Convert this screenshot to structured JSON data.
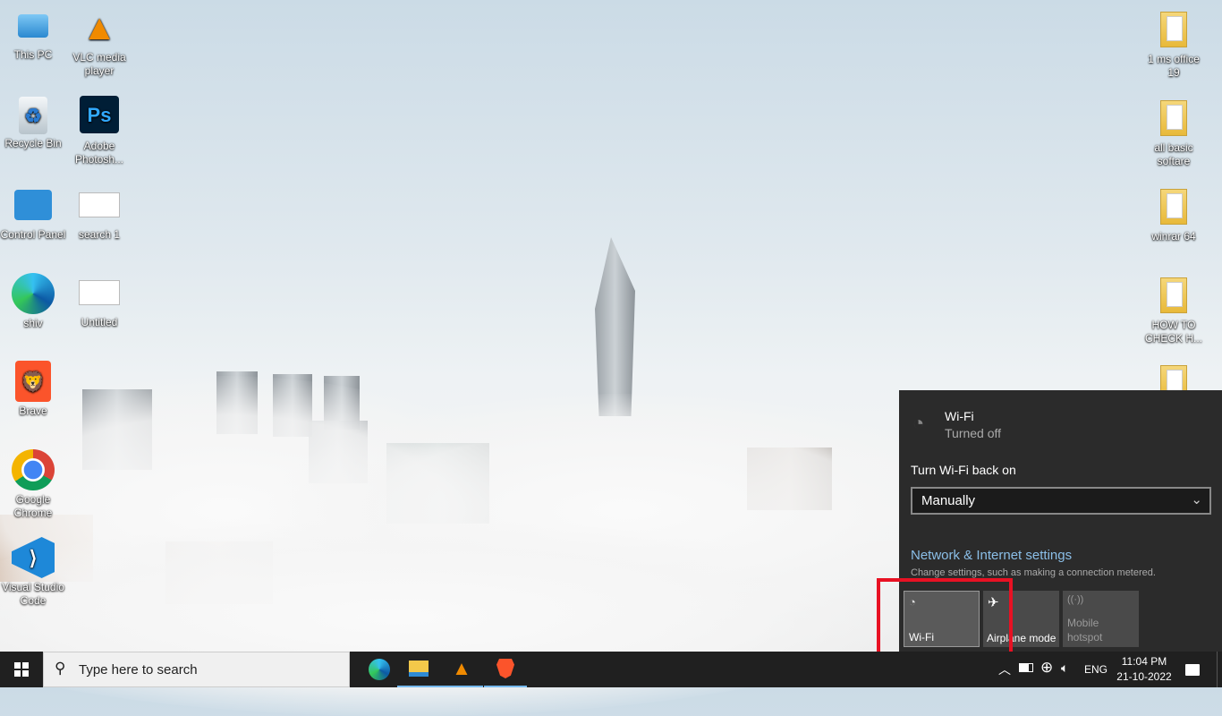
{
  "desktop": {
    "left_icons": [
      {
        "label": "This PC",
        "icon": "computer-icon"
      },
      {
        "label": "Recycle Bin",
        "icon": "recycle-bin-icon"
      },
      {
        "label": "Control Panel",
        "icon": "control-panel-icon"
      },
      {
        "label": "shiv",
        "icon": "edge-icon"
      },
      {
        "label": "Brave",
        "icon": "brave-icon"
      },
      {
        "label": "Google Chrome",
        "icon": "chrome-icon"
      },
      {
        "label": "Visual Studio Code",
        "icon": "vscode-icon"
      }
    ],
    "second_icons": [
      {
        "label": "VLC media player",
        "icon": "vlc-icon"
      },
      {
        "label": "Adobe Photosh...",
        "icon": "photoshop-icon",
        "glyph": "Ps"
      },
      {
        "label": "search 1",
        "icon": "document-thumbnail-icon"
      },
      {
        "label": "Untitled",
        "icon": "document-thumbnail-icon"
      }
    ],
    "right_icons": [
      {
        "label": "1 ms office 19",
        "icon": "folder-icon"
      },
      {
        "label": "all basic softare",
        "icon": "folder-icon"
      },
      {
        "label": "winrar 64",
        "icon": "folder-icon"
      },
      {
        "label": "HOW TO CHECK H...",
        "icon": "folder-icon"
      }
    ]
  },
  "network_flyout": {
    "wifi_title": "Wi-Fi",
    "wifi_status": "Turned off",
    "turn_on_label": "Turn Wi-Fi back on",
    "turn_on_value": "Manually",
    "settings_link": "Network & Internet settings",
    "settings_desc": "Change settings, such as making a connection metered.",
    "tiles": [
      {
        "label": "Wi-Fi",
        "icon": "wifi-icon",
        "state": "off"
      },
      {
        "label": "Airplane mode",
        "icon": "airplane-icon",
        "state": "off"
      },
      {
        "label": "Mobile hotspot",
        "icon": "hotspot-icon",
        "state": "disabled"
      }
    ],
    "accent": "#8bbfe8",
    "highlight": "#e81123"
  },
  "taskbar": {
    "search_placeholder": "Type here to search",
    "pinned": [
      "edge-icon",
      "file-explorer-icon",
      "vlc-icon",
      "brave-icon"
    ],
    "language": "ENG",
    "time": "11:04 PM",
    "date": "21-10-2022"
  }
}
